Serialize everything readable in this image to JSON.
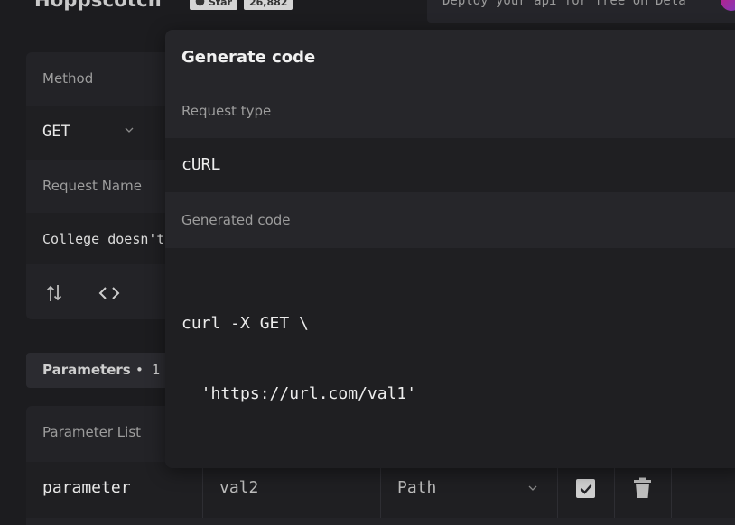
{
  "header": {
    "brand": "Hoppscotch",
    "github_star_label": "Star",
    "github_star_count": "26,882",
    "deploy_banner": "Deploy your api for free on Deta"
  },
  "request": {
    "method_label": "Method",
    "method_value": "GET",
    "name_label": "Request Name",
    "name_value": "College doesn't"
  },
  "parameters": {
    "tab_label": "Parameters",
    "separator": "•",
    "count": "1",
    "list_label": "Parameter List",
    "rows": [
      {
        "key": "parameter",
        "value": "val2",
        "type": "Path",
        "enabled": true
      }
    ]
  },
  "modal": {
    "title": "Generate code",
    "request_type_label": "Request type",
    "request_type_value": "cURL",
    "generated_code_label": "Generated code",
    "code_line_1": "curl -X GET \\",
    "code_line_2": "  'https://url.com/val1'"
  },
  "icons": {
    "swap": "swap-vertical-icon",
    "code": "code-brackets-icon",
    "github": "github-icon",
    "check": "checkbox-checked-icon",
    "trash": "trash-icon",
    "chevron": "chevron-down-icon"
  },
  "colors": {
    "background": "#1c1c1f",
    "panel": "#232327",
    "modal": "#26262a",
    "text": "#e2e2e2",
    "muted": "#9d9d9d"
  }
}
